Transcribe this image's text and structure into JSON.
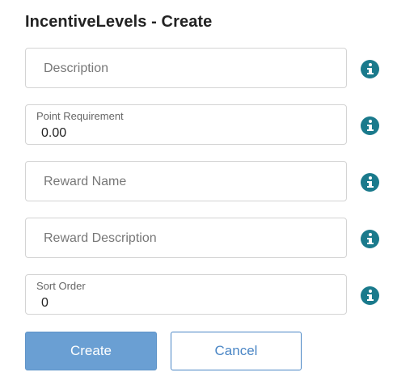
{
  "page": {
    "title": "IncentiveLevels - Create"
  },
  "form": {
    "description": {
      "placeholder": "Description"
    },
    "point_requirement": {
      "label": "Point Requirement",
      "value": "0.00"
    },
    "reward_name": {
      "placeholder": "Reward Name"
    },
    "reward_description": {
      "placeholder": "Reward Description"
    },
    "sort_order": {
      "label": "Sort Order",
      "value": "0"
    }
  },
  "buttons": {
    "create_label": "Create",
    "cancel_label": "Cancel"
  },
  "icons": {
    "info": "info-icon"
  },
  "colors": {
    "accent": "#1a7a8c",
    "primary_button": "#6a9fd3",
    "cancel_text": "#4a86c5"
  }
}
